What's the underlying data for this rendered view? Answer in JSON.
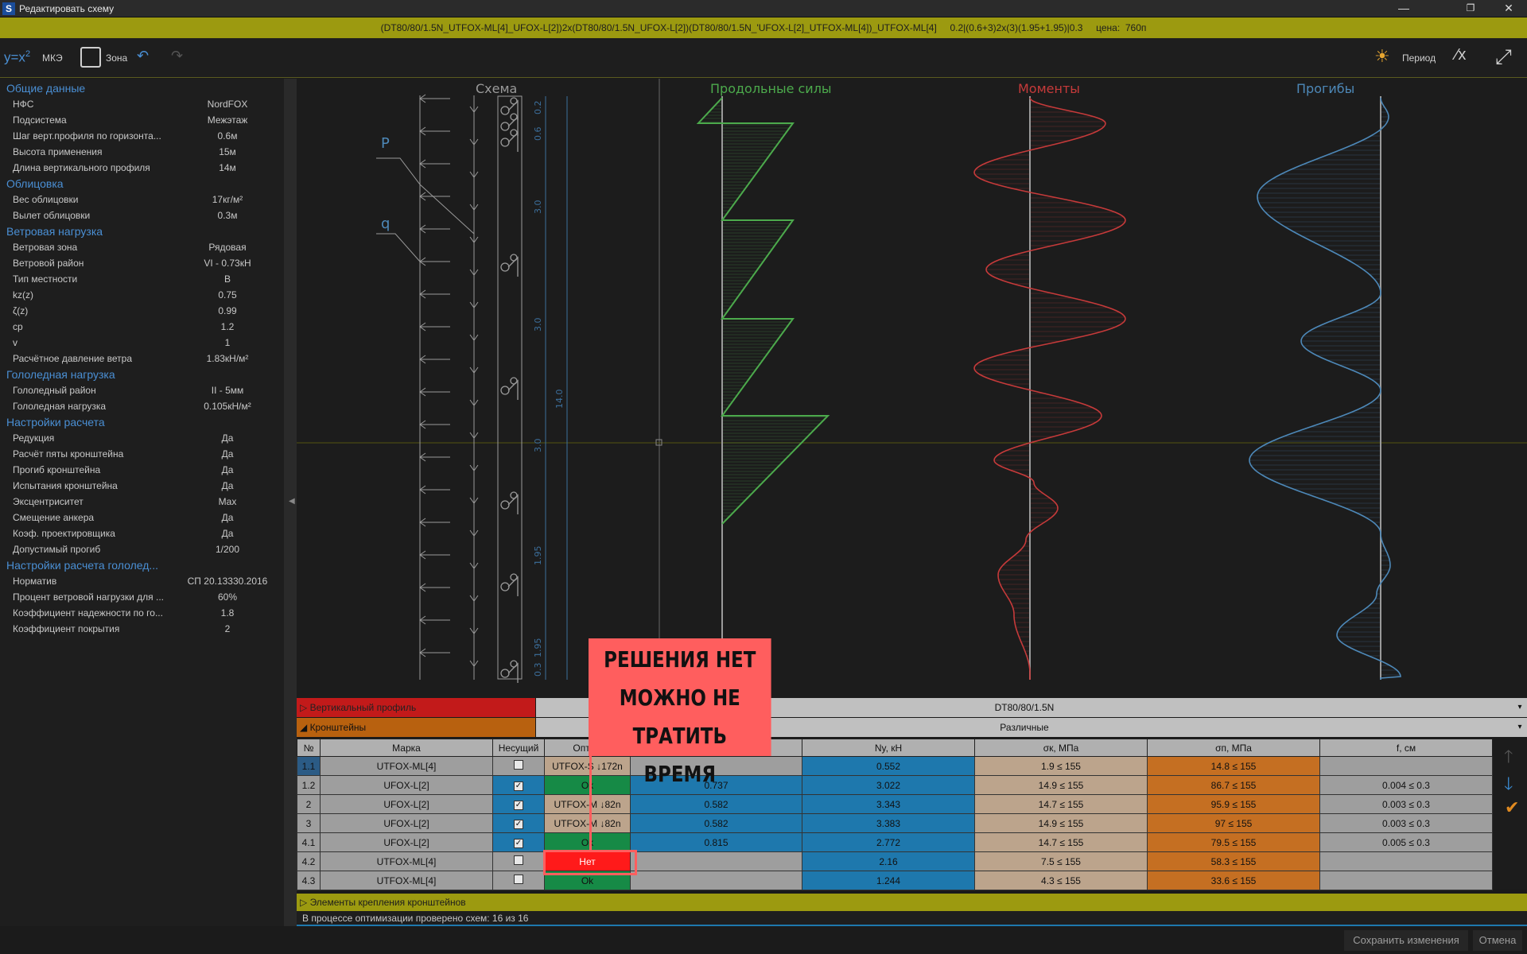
{
  "window": {
    "title": "Редактировать схему",
    "icon": "S"
  },
  "scheme_bar": {
    "text": "(DT80/80/1.5N_UTFOX-ML[4]_UFOX-L[2])2x(DT80/80/1.5N_UFOX-L[2])(DT80/80/1.5N_'UFOX-L[2]_UTFOX-ML[4])_UTFOX-ML[4]     0.2|(0.6+3)2x(3)(1.95+1.95)|0.3     цена:  760п"
  },
  "toolbar": {
    "formula": "y=x",
    "formula_exp": "2",
    "method": "МКЭ",
    "zone": "Зона",
    "period": "Период"
  },
  "left_panel": {
    "sections": [
      {
        "title": "Общие данные",
        "rows": [
          [
            "НФС",
            "NordFOX"
          ],
          [
            "Подсистема",
            "Межэтаж"
          ],
          [
            "Шаг верт.профиля по горизонта...",
            "0.6м"
          ],
          [
            "Высота применения",
            "15м"
          ],
          [
            "Длина вертикального профиля",
            "14м"
          ]
        ]
      },
      {
        "title": "Облицовка",
        "rows": [
          [
            "Вес облицовки",
            "17кг/м²"
          ],
          [
            "Вылет облицовки",
            "0.3м"
          ]
        ]
      },
      {
        "title": "Ветровая нагрузка",
        "rows": [
          [
            "Ветровая зона",
            "Рядовая"
          ],
          [
            "Ветровой район",
            "VI - 0.73кН"
          ],
          [
            "Тип местности",
            "В"
          ],
          [
            "kz(z)",
            "0.75"
          ],
          [
            "ζ(z)",
            "0.99"
          ],
          [
            "cp",
            "1.2"
          ],
          [
            "v",
            "1"
          ],
          [
            "Расчётное давление ветра",
            "1.83кН/м²"
          ]
        ]
      },
      {
        "title": "Гололедная нагрузка",
        "rows": [
          [
            "Гололедный район",
            "II - 5мм"
          ],
          [
            "Гололедная нагрузка",
            "0.105кН/м²"
          ]
        ]
      },
      {
        "title": "Настройки расчета",
        "rows": [
          [
            "Редукция",
            "Да"
          ],
          [
            "Расчёт пяты кронштейна",
            "Да"
          ],
          [
            "Прогиб кронштейна",
            "Да"
          ],
          [
            "Испытания кронштейна",
            "Да"
          ],
          [
            "Эксцентриситет",
            "Max"
          ],
          [
            "Смещение анкера",
            "Да"
          ],
          [
            "Коэф. проектировщика",
            "Да"
          ],
          [
            "Допустимый прогиб",
            "1/200"
          ]
        ]
      },
      {
        "title": "Настройки расчета гололед...",
        "rows": [
          [
            "Норматив",
            "СП 20.13330.2016"
          ],
          [
            "Процент ветровой нагрузки для ...",
            "60%"
          ],
          [
            "Коэффициент надежности по го...",
            "1.8"
          ],
          [
            "Коэффициент покрытия",
            "2"
          ]
        ]
      }
    ]
  },
  "viewer": {
    "headers": {
      "scheme": "Схема",
      "axial": "Продольные силы",
      "moments": "Моменты",
      "deflections": "Прогибы"
    },
    "load_labels": {
      "p": "P",
      "q": "q"
    },
    "dimensions": [
      "0.6",
      "0.2",
      "3.0",
      "3.0",
      "3.0",
      "1.95",
      "1.95",
      "0.3",
      "14.0"
    ],
    "colors": {
      "axial": "#4caa4c",
      "moments": "#c63a3a",
      "deflections": "#4d88b8",
      "scheme": "#9a9a9a",
      "dim": "#3c6f9c"
    }
  },
  "groups": [
    {
      "label": "Вертикальный профиль",
      "value": "DT80/80/1.5N"
    },
    {
      "label": "Кронштейны",
      "value": "Различные"
    }
  ],
  "table": {
    "headers": [
      "№",
      "Марка",
      "Несущий",
      "Оптим",
      "",
      "Ny, кН",
      "σк, МПа",
      "σп, МПа",
      "f, см"
    ],
    "rows": [
      {
        "n": "1.1",
        "mark": "UTFOX-ML[4]",
        "carrier": false,
        "opt": "UTFOX-S ↓172n",
        "c5": "",
        "ny": "0.552",
        "sk": "1.9 ≤ 155",
        "sp": "14.8 ≤ 155",
        "f": ""
      },
      {
        "n": "1.2",
        "mark": "UFOX-L[2]",
        "carrier": true,
        "opt": "Ok",
        "c5": "0.737",
        "ny": "3.022",
        "sk": "14.9 ≤ 155",
        "sp": "86.7 ≤ 155",
        "f": "0.004 ≤ 0.3"
      },
      {
        "n": "2",
        "mark": "UFOX-L[2]",
        "carrier": true,
        "opt": "UTFOX-M ↓82n",
        "c5": "0.582",
        "ny": "3.343",
        "sk": "14.7 ≤ 155",
        "sp": "95.9 ≤ 155",
        "f": "0.003 ≤ 0.3"
      },
      {
        "n": "3",
        "mark": "UFOX-L[2]",
        "carrier": true,
        "opt": "UTFOX-M ↓82n",
        "c5": "0.582",
        "ny": "3.383",
        "sk": "14.9 ≤ 155",
        "sp": "97 ≤ 155",
        "f": "0.003 ≤ 0.3"
      },
      {
        "n": "4.1",
        "mark": "UFOX-L[2]",
        "carrier": true,
        "opt": "Ok",
        "c5": "0.815",
        "ny": "2.772",
        "sk": "14.7 ≤ 155",
        "sp": "79.5 ≤ 155",
        "f": "0.005 ≤ 0.3"
      },
      {
        "n": "4.2",
        "mark": "UTFOX-ML[4]",
        "carrier": false,
        "opt": "Нет",
        "c5": "",
        "ny": "2.16",
        "sk": "7.5 ≤ 155",
        "sp": "58.3 ≤ 155",
        "f": ""
      },
      {
        "n": "4.3",
        "mark": "UTFOX-ML[4]",
        "carrier": false,
        "opt": "Ok",
        "c5": "",
        "ny": "1.244",
        "sk": "4.3 ≤ 155",
        "sp": "33.6 ≤ 155",
        "f": ""
      }
    ]
  },
  "fix_bar": {
    "label": "Элементы крепления кронштейнов"
  },
  "status": {
    "text": "В процессе оптимизации проверено схем: 16 из 16"
  },
  "buttons": {
    "save": "Сохранить изменения",
    "cancel": "Отмена"
  },
  "callout": {
    "line1": "РЕШЕНИЯ НЕТ",
    "line2": "МОЖНО НЕ ТРАТИТЬ",
    "line3": "ВРЕМЯ"
  }
}
